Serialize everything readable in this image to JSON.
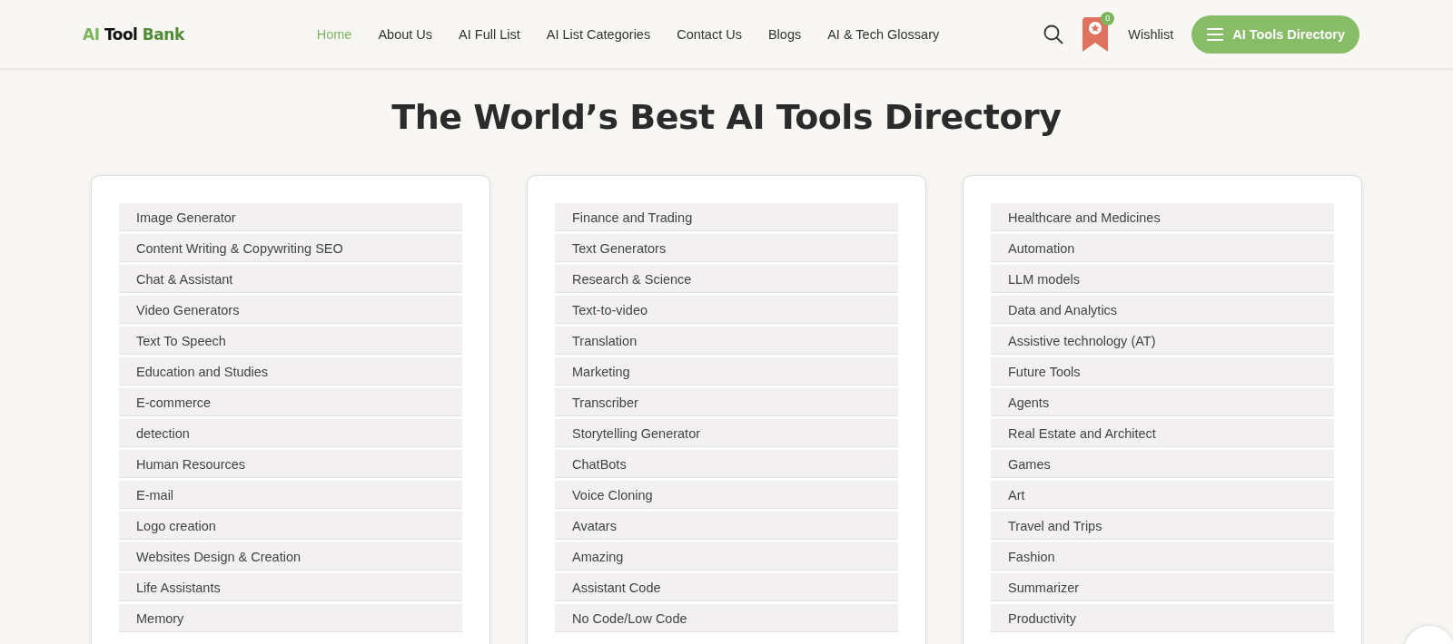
{
  "logo": [
    {
      "text": "AI",
      "kind": "light"
    },
    {
      "text": "Tool",
      "kind": "dark"
    },
    {
      "text": "Bank",
      "kind": "strong"
    }
  ],
  "nav": [
    {
      "label": "Home",
      "selected": true
    },
    {
      "label": "About Us",
      "selected": false
    },
    {
      "label": "AI Full List",
      "selected": false
    },
    {
      "label": "AI List Categories",
      "selected": false
    },
    {
      "label": "Contact Us",
      "selected": false
    },
    {
      "label": "Blogs",
      "selected": false
    },
    {
      "label": "AI & Tech Glossary",
      "selected": false
    }
  ],
  "wishlist": {
    "count": "0",
    "label": "Wishlist"
  },
  "directory_button": "AI Tools Directory",
  "heading": "The World’s Best AI Tools Directory",
  "columns": [
    [
      "Image Generator",
      "Content Writing & Copywriting SEO",
      "Chat & Assistant",
      "Video Generators",
      "Text To Speech",
      "Education and Studies",
      "E-commerce",
      "detection",
      "Human Resources",
      "E-mail",
      "Logo creation",
      "Websites Design & Creation",
      "Life Assistants",
      "Memory"
    ],
    [
      "Finance and Trading",
      "Text Generators",
      "Research & Science",
      "Text-to-video",
      "Translation",
      "Marketing",
      "Transcriber",
      "Storytelling Generator",
      "ChatBots",
      "Voice Cloning",
      "Avatars",
      "Amazing",
      "Assistant Code",
      "No Code/Low Code"
    ],
    [
      "Healthcare and Medicines",
      "Automation",
      "LLM models",
      "Data and Analytics",
      "Assistive technology (AT)",
      "Future Tools",
      "Agents",
      "Real Estate and Architect",
      "Games",
      "Art",
      "Travel and Trips",
      "Fashion",
      "Summarizer",
      "Productivity"
    ]
  ]
}
